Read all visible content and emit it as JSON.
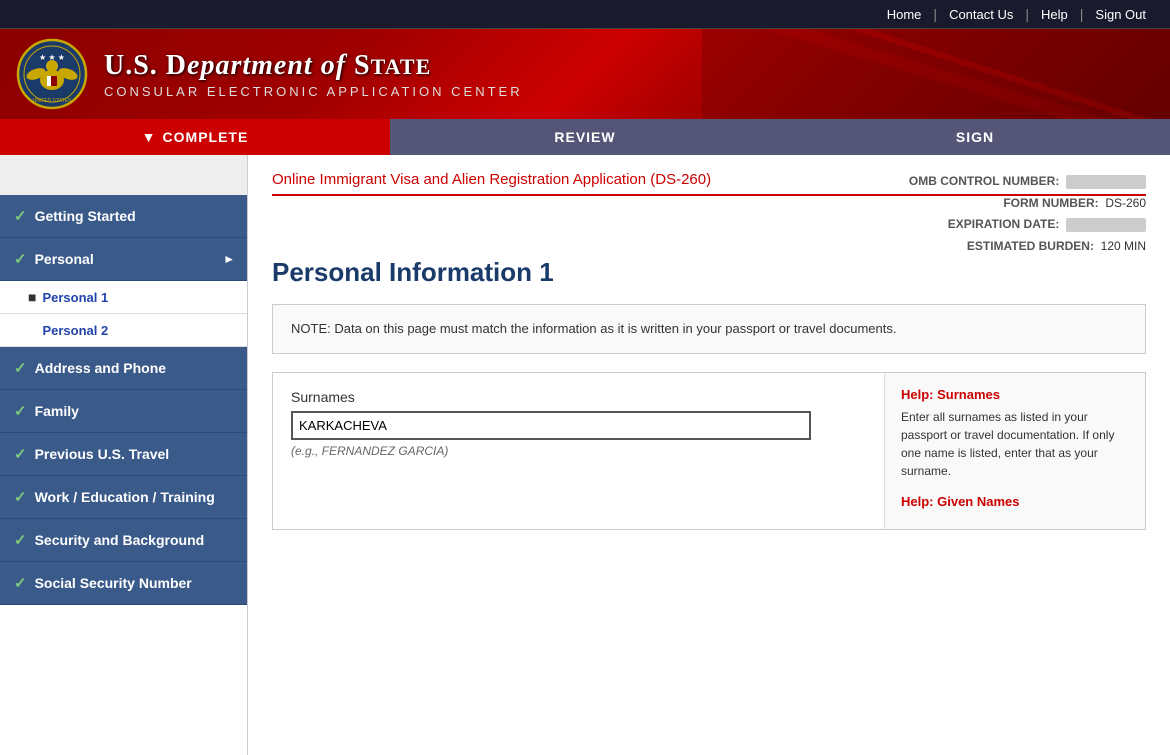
{
  "topnav": {
    "home": "Home",
    "contact": "Contact Us",
    "help": "Help",
    "signout": "Sign Out"
  },
  "header": {
    "dept_line1": "U.S. D",
    "dept_name": "U.S. DEPARTMENT of STATE",
    "subtitle": "CONSULAR ELECTRONIC APPLICATION CENTER"
  },
  "progress": {
    "complete": "COMPLETE",
    "review": "REVIEW",
    "sign": "SIGN"
  },
  "sidebar": {
    "items": [
      {
        "label": "Getting Started",
        "check": true
      },
      {
        "label": "Personal",
        "check": true,
        "hasArrow": true
      },
      {
        "label": "Personal 1",
        "sub": true,
        "active": true
      },
      {
        "label": "Personal 2",
        "sub": true
      },
      {
        "label": "Address and Phone",
        "check": true
      },
      {
        "label": "Family",
        "check": true
      },
      {
        "label": "Previous U.S. Travel",
        "check": true
      },
      {
        "label": "Work / Education / Training",
        "check": true
      },
      {
        "label": "Security and Background",
        "check": true
      },
      {
        "label": "Social Security Number",
        "check": true
      }
    ]
  },
  "content": {
    "subtitle": "Online Immigrant Visa and Alien Registration Application (DS-260)",
    "form_meta": {
      "omb_label": "OMB CONTROL NUMBER:",
      "form_label": "FORM NUMBER:",
      "form_value": "DS-260",
      "exp_label": "EXPIRATION DATE:",
      "burden_label": "ESTIMATED BURDEN:",
      "burden_value": "120 MIN"
    },
    "page_title": "Personal Information 1",
    "note": "NOTE: Data on this page must match the information as it is written in your passport or travel documents.",
    "surnames_label": "Surnames",
    "surnames_value": "KARKACHEVA",
    "surnames_hint": "(e.g., FERNANDEZ GARCIA)",
    "help_surnames_title": "Help: Surnames",
    "help_surnames_text": "Enter all surnames as listed in your passport or travel documentation. If only one name is listed, enter that as your surname.",
    "help_given_title": "Help: Given Names"
  }
}
